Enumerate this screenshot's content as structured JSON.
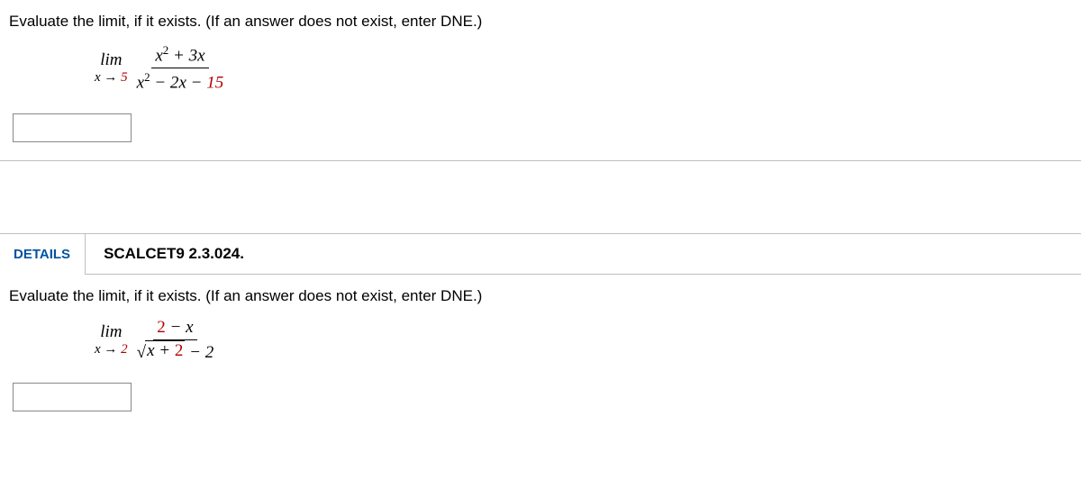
{
  "q1": {
    "prompt": "Evaluate the limit, if it exists. (If an answer does not exist, enter DNE.)",
    "lim_word": "lim",
    "lim_sub": "x → 5",
    "numerator_plain": "x² + 3x",
    "denominator_plain": "x² − 2x − 15"
  },
  "header": {
    "details_label": "DETAILS",
    "ref": "SCALCET9 2.3.024."
  },
  "q2": {
    "prompt": "Evaluate the limit, if it exists. (If an answer does not exist, enter DNE.)",
    "lim_word": "lim",
    "lim_sub": "x → 2",
    "numerator_plain": "2 − x",
    "denominator_sqrt_plain": "x + 2",
    "denominator_tail": " − 2"
  }
}
